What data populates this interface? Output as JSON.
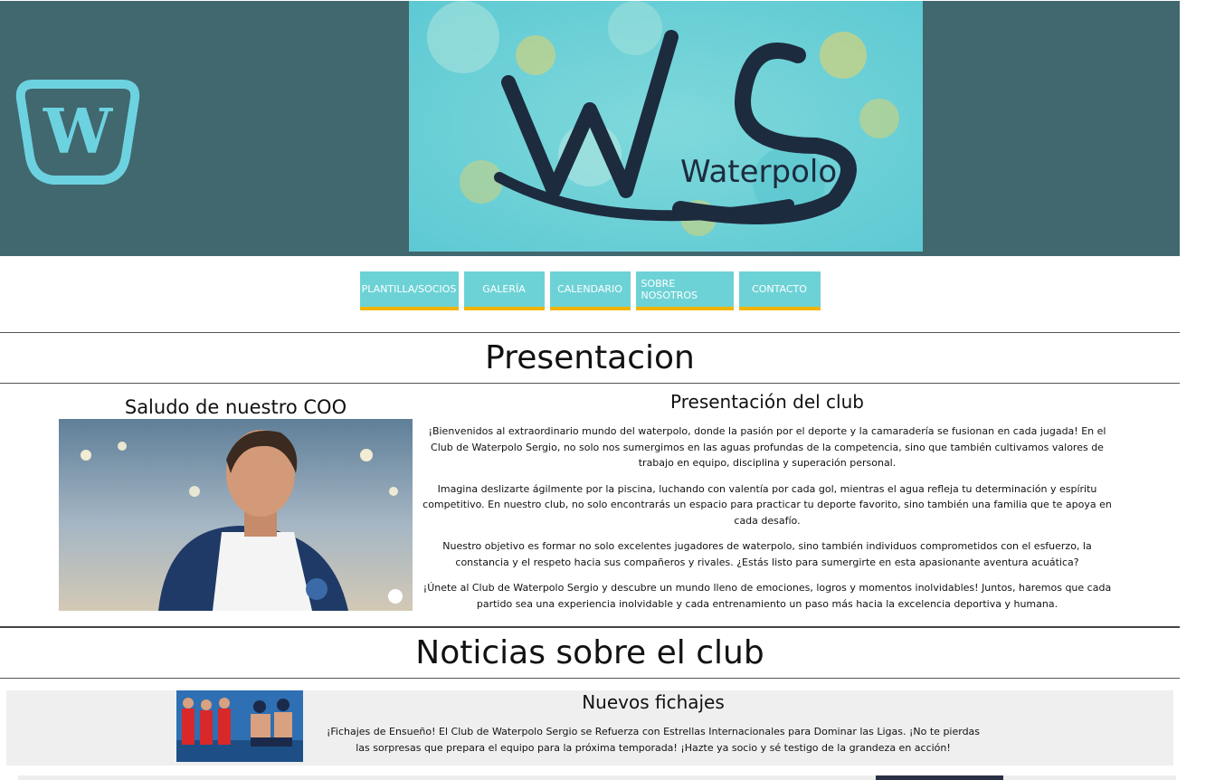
{
  "header": {
    "logo_icon": "wordpress-logo-icon",
    "banner_text": "Waterpolo",
    "banner_initials": "WS"
  },
  "nav": {
    "items": [
      {
        "label": "PLANTILLA/SOCIOS"
      },
      {
        "label": "GALERÍA"
      },
      {
        "label": "CALENDARIO"
      },
      {
        "label": "SOBRE NOSOTROS"
      },
      {
        "label": "CONTACTO"
      }
    ]
  },
  "presentation": {
    "section_title": "Presentacion",
    "coo_title": "Saludo de nuestro COO",
    "club_title": "Presentación del club",
    "paragraphs": [
      "¡Bienvenidos al extraordinario mundo del waterpolo, donde la pasión por el deporte y la camaradería se fusionan en cada jugada! En el Club de Waterpolo Sergio, no solo nos sumergimos en las aguas profundas de la competencia, sino que también cultivamos valores de trabajo en equipo, disciplina y superación personal.",
      "Imagina deslizarte ágilmente por la piscina, luchando con valentía por cada gol, mientras el agua refleja tu determinación y espíritu competitivo. En nuestro club, no solo encontrarás un espacio para practicar tu deporte favorito, sino también una familia que te apoya en cada desafío.",
      "Nuestro objetivo es formar no solo excelentes jugadores de waterpolo, sino también individuos comprometidos con el esfuerzo, la constancia y el respeto hacia sus compañeros y rivales. ¿Estás listo para sumergirte en esta apasionante aventura acuática?",
      "¡Únete al Club de Waterpolo Sergio y descubre un mundo lleno de emociones, logros y momentos inolvidables! Juntos, haremos que cada partido sea una experiencia inolvidable y cada entrenamiento un paso más hacia la excelencia deportiva y humana."
    ]
  },
  "news": {
    "section_title": "Noticias sobre el club",
    "items": [
      {
        "title": "Nuevos fichajes",
        "text": "¡Fichajes de Ensueño! El Club de Waterpolo Sergio se Refuerza con Estrellas Internacionales para Dominar las Ligas. ¡No te pierdas las sorpresas que prepara el equipo para la próxima temporada! ¡Hazte ya socio y sé testigo de la grandeza en acción!"
      }
    ]
  },
  "colors": {
    "header_bg": "#41676f",
    "nav_bg": "#6dd2d6",
    "nav_accent": "#f0b400",
    "logo": "#6dd2e0"
  }
}
